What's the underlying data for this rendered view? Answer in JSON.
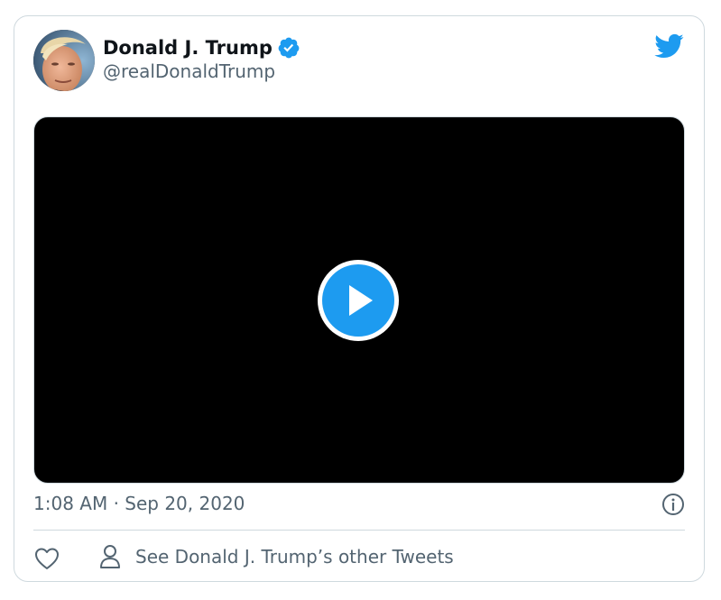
{
  "tweet": {
    "author_name": "Donald J. Trump",
    "author_handle": "@realDonaldTrump",
    "verified": true,
    "timestamp": "1:08 AM · Sep 20, 2020",
    "other_tweets_label": "See Donald J. Trump’s other Tweets"
  },
  "icons": {
    "brand": "twitter-bird-icon",
    "verified": "verified-badge-icon",
    "play": "play-icon",
    "info": "info-icon",
    "like": "heart-icon",
    "profile": "person-icon"
  },
  "colors": {
    "brand": "#1d9bf0",
    "text_primary": "#0f1419",
    "text_secondary": "#536471",
    "border": "#cfd9de",
    "video_bg": "#000000"
  }
}
